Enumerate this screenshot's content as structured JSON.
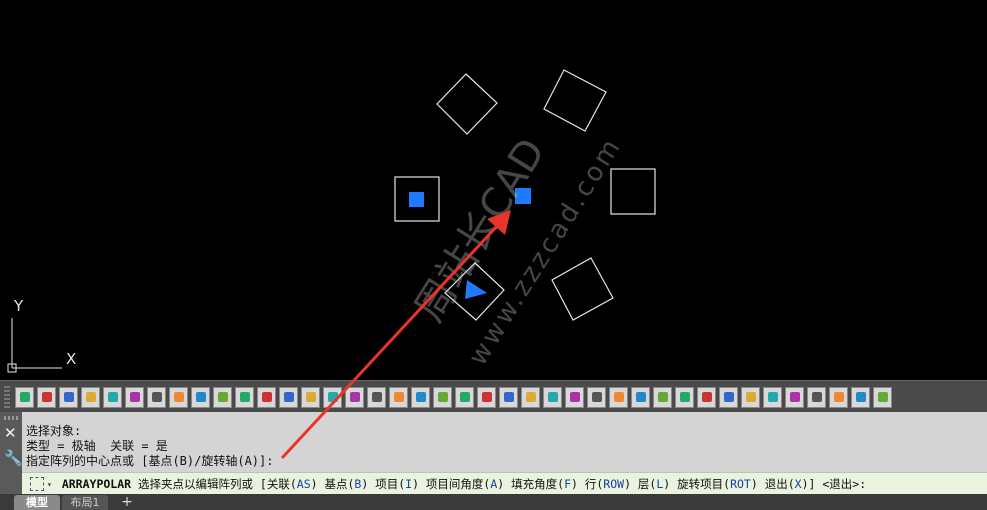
{
  "canvas": {
    "ucs_x_label": "X",
    "ucs_y_label": "Y",
    "watermark_line1": "周站长CAD",
    "watermark_line2": "www.zzzcad.com",
    "highlight_color": "#1e7bff",
    "arrow_color": "#e8352b"
  },
  "toolbar": {
    "buttons": [
      "layers",
      "save",
      "zoom",
      "properties",
      "matchprop",
      "circle",
      "circles",
      "move",
      "rotate",
      "mirror",
      "offset",
      "mirror2",
      "array",
      "erase",
      "stretch",
      "rectangle",
      "line",
      "dimension",
      "polyline",
      "region",
      "divide",
      "insert",
      "copy",
      "hatch",
      "column",
      "block",
      "text",
      "mtext",
      "attach",
      "table",
      "multiedit",
      "group",
      "explode",
      "lock",
      "layer2",
      "3d-box",
      "3d-solid",
      "render",
      "grid",
      "camera"
    ]
  },
  "command": {
    "history": [
      "选择对象:",
      "类型 = 极轴  关联 = 是",
      "指定阵列的中心点或 [基点(B)/旋转轴(A)]:"
    ],
    "name": "ARRAYPOLAR",
    "prompt_parts": [
      {
        "t": " 选择夹点以编辑阵列或 [关联(",
        "kw": false
      },
      {
        "t": "AS",
        "kw": true
      },
      {
        "t": ") 基点(",
        "kw": false
      },
      {
        "t": "B",
        "kw": true
      },
      {
        "t": ") 项目(",
        "kw": false
      },
      {
        "t": "I",
        "kw": true
      },
      {
        "t": ") 项目间角度(",
        "kw": false
      },
      {
        "t": "A",
        "kw": true
      },
      {
        "t": ") 填充角度(",
        "kw": false
      },
      {
        "t": "F",
        "kw": true
      },
      {
        "t": ") 行(",
        "kw": false
      },
      {
        "t": "ROW",
        "kw": true
      },
      {
        "t": ") 层(",
        "kw": false
      },
      {
        "t": "L",
        "kw": true
      },
      {
        "t": ") 旋转项目(",
        "kw": false
      },
      {
        "t": "ROT",
        "kw": true
      },
      {
        "t": ") 退出(",
        "kw": false
      },
      {
        "t": "X",
        "kw": true
      },
      {
        "t": ")] <退出>:",
        "kw": false
      }
    ]
  },
  "tabs": {
    "model": "模型",
    "layout1": "布局1",
    "add": "+"
  }
}
